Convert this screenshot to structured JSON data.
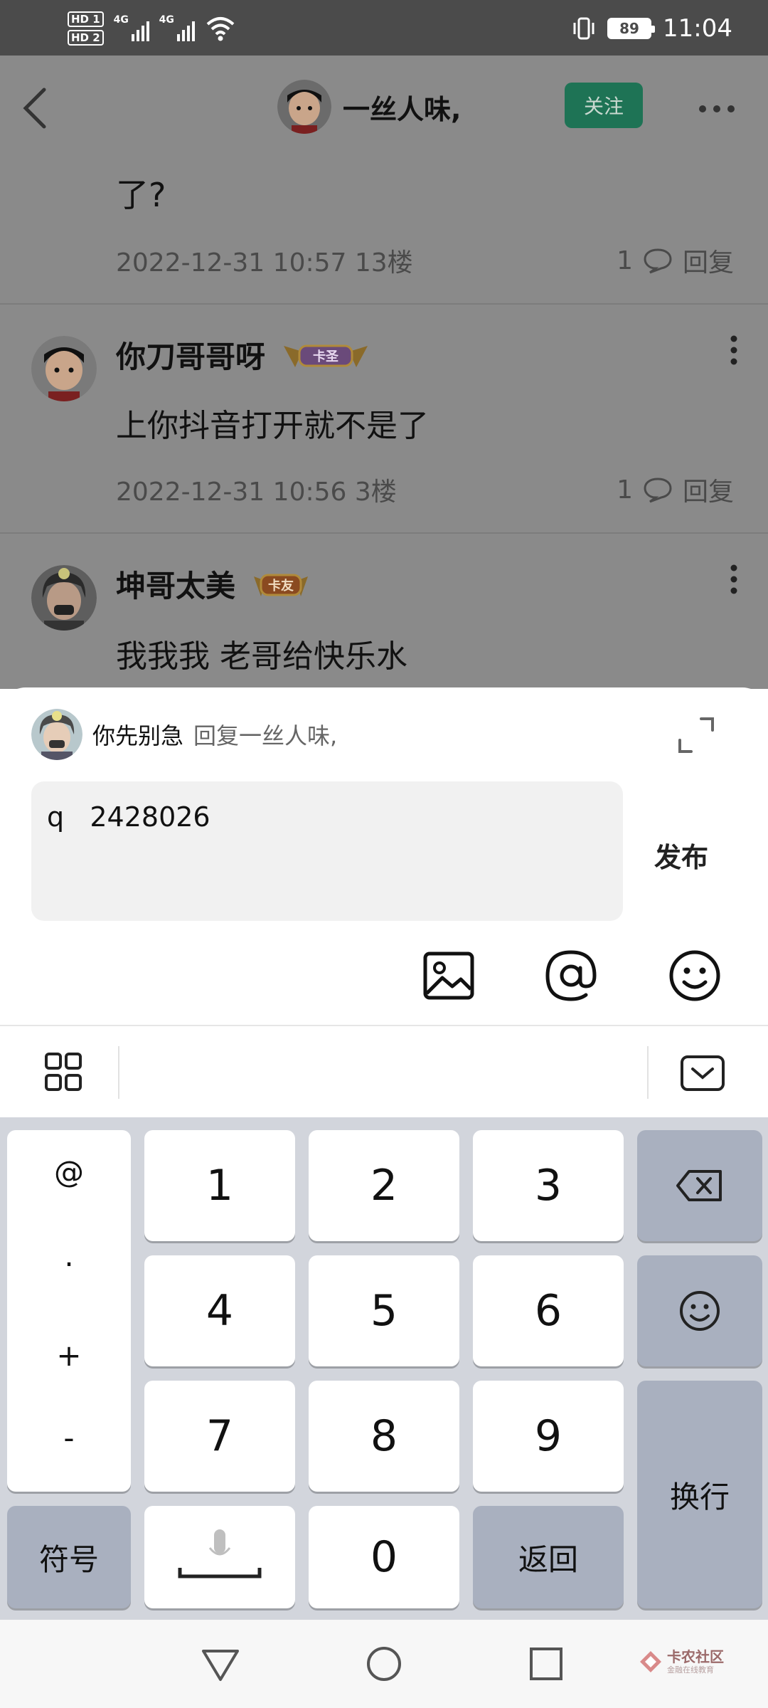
{
  "status_bar": {
    "hd1": "HD 1",
    "hd2": "HD 2",
    "net1": "4G",
    "net2": "4G",
    "battery": "89",
    "time": "11:04"
  },
  "topbar": {
    "author_name": "一丝人味,",
    "follow_label": "关注"
  },
  "thread": {
    "previous_text_tail": "了?",
    "previous_meta": "2022-12-31 10:57  13楼",
    "previous_likes": "1",
    "reply_label": "回复",
    "comments": [
      {
        "user": "你刀哥哥呀",
        "badge": "卡圣",
        "text": "上你抖音打开就不是了",
        "meta": "2022-12-31 10:56  3楼",
        "likes": "1"
      },
      {
        "user": "坤哥太美",
        "badge": "卡友",
        "text": "我我我 老哥给快乐水"
      }
    ]
  },
  "reply_sheet": {
    "current_user": "你先别急",
    "reply_target": "回复一丝人味,",
    "input_value": "q   2428026",
    "publish_label": "发布",
    "icons": [
      "image-icon",
      "at-icon",
      "emoji-icon"
    ]
  },
  "keyboard": {
    "symbols": [
      "@",
      ".",
      "+",
      "-"
    ],
    "digits": [
      "1",
      "2",
      "3",
      "4",
      "5",
      "6",
      "7",
      "8",
      "9",
      "0"
    ],
    "symbol_key": "符号",
    "return_key": "返回",
    "newline_key": "换行"
  },
  "watermark": {
    "title": "卡农社区",
    "subtitle": "金融在线教育"
  }
}
